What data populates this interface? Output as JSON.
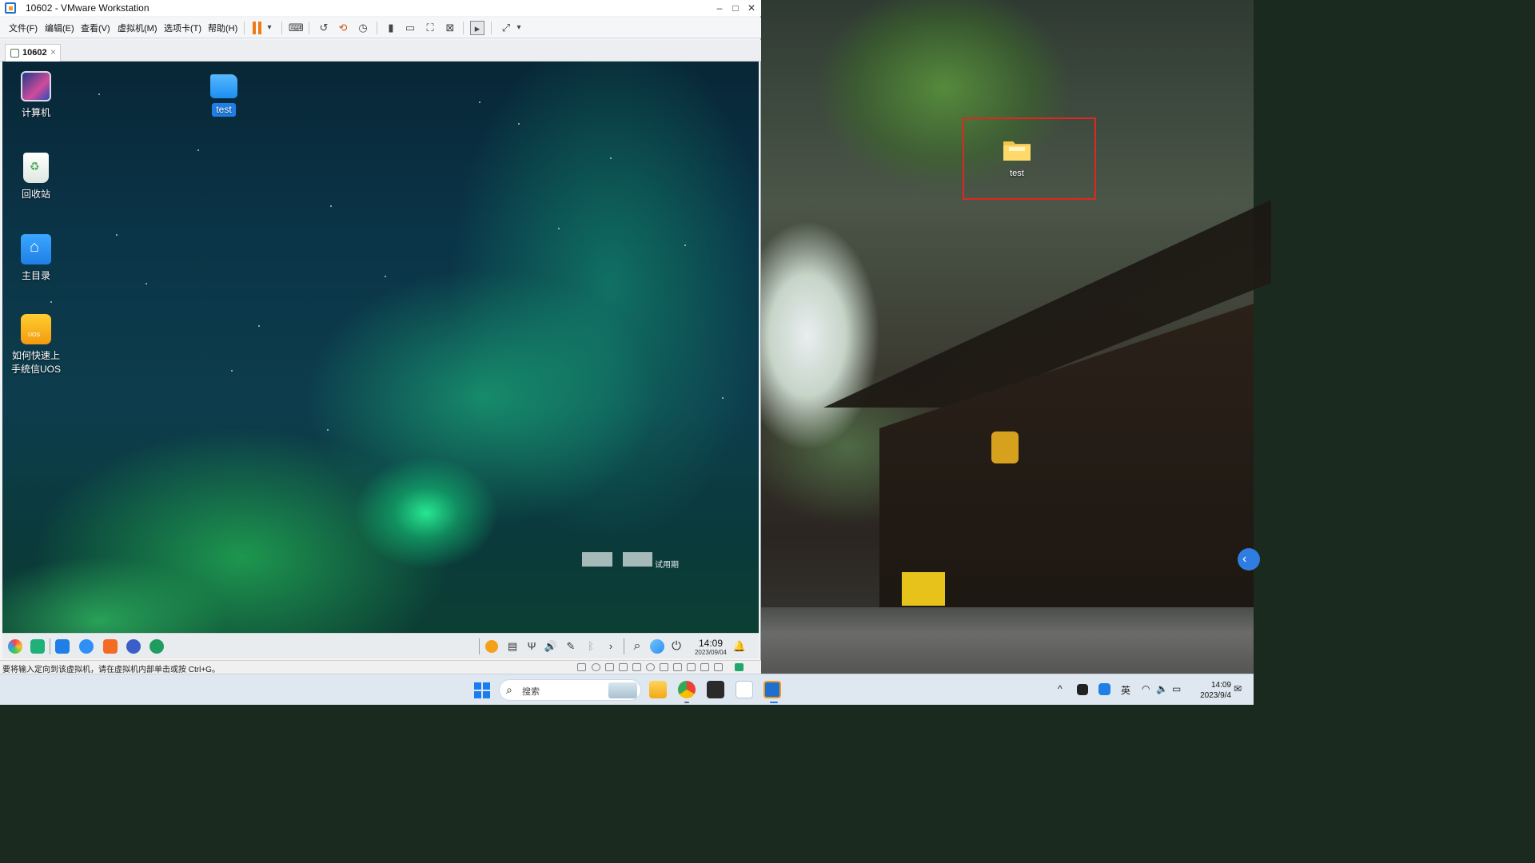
{
  "host": {
    "desktop_icon_label": "test",
    "side_button_glyph": "‹"
  },
  "window": {
    "title": "10602 - VMware Workstation",
    "controls": {
      "minimize": "–",
      "maximize": "□",
      "close": "✕"
    },
    "menu": [
      "文件(F)",
      "编辑(E)",
      "查看(V)",
      "虚拟机(M)",
      "选项卡(T)",
      "帮助(H)"
    ],
    "toolbar_glyphs": {
      "pause_dropdown": "▾",
      "send_keys": "⌨",
      "snapshot": "↺",
      "revert": "⟲",
      "snapshot_manager": "◷",
      "view_sidebar": "▮",
      "view_console": "▭",
      "fullscreen": "⛶",
      "unity": "⊠",
      "terminal": "▸",
      "stretch": "⤢",
      "stretch_dropdown": "▾"
    },
    "tab": {
      "label": "10602",
      "close": "×"
    },
    "status_text": "要将输入定向到该虚拟机，请在虚拟机内部单击或按 Ctrl+G。"
  },
  "guest": {
    "desktop_icons": [
      {
        "label": "计算机"
      },
      {
        "label": "回收站"
      },
      {
        "label": "主目录"
      },
      {
        "label_line1": "如何快速上",
        "label_line2": "手统信UOS"
      }
    ],
    "test_folder_label": "test",
    "trial_text": "试用期",
    "dock": {
      "tray_glyphs": {
        "keyboard": "▤",
        "usb": "Ψ",
        "volume": "🔊",
        "pen": "✎",
        "bluetooth": "ᛒ",
        "expand": "›",
        "search": "⌕",
        "power": "⏻",
        "notification": "🔔"
      },
      "time": "14:09",
      "date": "2023/09/04"
    }
  },
  "taskbar": {
    "search_placeholder": "搜索",
    "search_glyph": "⌕",
    "tray": {
      "chevron": "^",
      "ime": "英",
      "wifi": "◠",
      "volume": "🔈",
      "battery": "▭",
      "notification": "✉"
    },
    "time": "14:09",
    "date": "2023/9/4"
  },
  "colors": {
    "host_selection_box": "#e0261e",
    "guest_selected_label": "#1d7fe8",
    "vmware_pause": "#f07a14",
    "windows_accent": "#1b7cf0"
  }
}
